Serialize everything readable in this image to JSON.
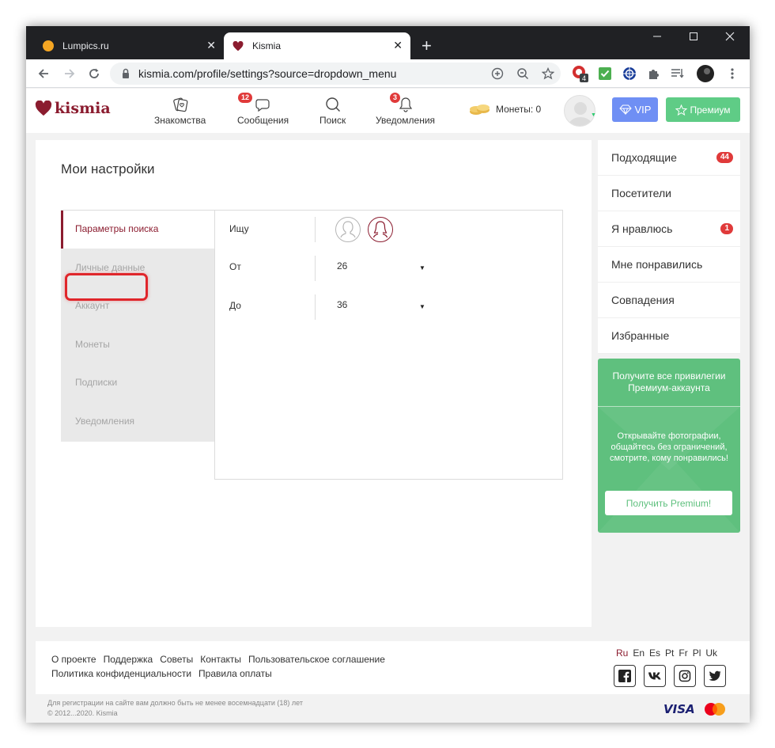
{
  "browser": {
    "tabs": [
      {
        "title": "Lumpics.ru",
        "active": false
      },
      {
        "title": "Kismia",
        "active": true
      }
    ],
    "new_tab": "+",
    "address": "kismia.com/profile/settings?source=dropdown_menu",
    "window_controls": {
      "minimize": "—",
      "maximize": "☐",
      "close": "✕"
    },
    "extension_badge": "4"
  },
  "site": {
    "logo_text": "kismia",
    "nav": [
      {
        "label": "Знакомства",
        "icon": "cards-icon",
        "badge": ""
      },
      {
        "label": "Сообщения",
        "icon": "chat-icon",
        "badge": "12"
      },
      {
        "label": "Поиск",
        "icon": "search-icon",
        "badge": ""
      },
      {
        "label": "Уведомления",
        "icon": "bell-icon",
        "badge": "3"
      }
    ],
    "coins_label": "Монеты: 0",
    "vip_label": "VIP",
    "premium_label": "Премиум"
  },
  "settings": {
    "title": "Мои настройки",
    "menu": [
      {
        "label": "Параметры поиска",
        "active": true
      },
      {
        "label": "Личные данные",
        "active": false
      },
      {
        "label": "Аккаунт",
        "active": false
      },
      {
        "label": "Монеты",
        "active": false
      },
      {
        "label": "Подписки",
        "active": false
      },
      {
        "label": "Уведомления",
        "active": false
      }
    ],
    "rows": {
      "seeking_label": "Ищу",
      "from_label": "От",
      "from_value": "26",
      "to_label": "До",
      "to_value": "36"
    }
  },
  "sidebar": {
    "items": [
      {
        "label": "Подходящие",
        "badge": "44"
      },
      {
        "label": "Посетители",
        "badge": ""
      },
      {
        "label": "Я нравлюсь",
        "badge": "1"
      },
      {
        "label": "Мне понравились",
        "badge": ""
      },
      {
        "label": "Совпадения",
        "badge": ""
      },
      {
        "label": "Избранные",
        "badge": ""
      }
    ],
    "promo_title": "Получите все привилегии Премиум-аккаунта",
    "promo_text": "Открывайте фотографии, общайтесь без ограничений, смотрите, кому понравились!",
    "promo_button": "Получить Premium!"
  },
  "footer": {
    "links_row1": [
      "О проекте",
      "Поддержка",
      "Советы",
      "Контакты",
      "Пользовательское соглашение"
    ],
    "links_row2": [
      "Политика конфиденциальности",
      "Правила оплаты"
    ],
    "languages": [
      "Ru",
      "En",
      "Es",
      "Pt",
      "Fr",
      "Pl",
      "Uk"
    ],
    "social": [
      "facebook-icon",
      "vk-icon",
      "instagram-icon",
      "twitter-icon"
    ],
    "legal_line1": "Для регистрации на сайте вам должно быть не менее восемнадцати (18) лет",
    "legal_line2": "© 2012...2020. Kismia",
    "visa": "VISA"
  },
  "colors": {
    "brand": "#8b1c2f",
    "vip": "#6f8ff4",
    "premium": "#5fcc86",
    "badge": "#e03a3a",
    "highlight": "#e0262b"
  }
}
